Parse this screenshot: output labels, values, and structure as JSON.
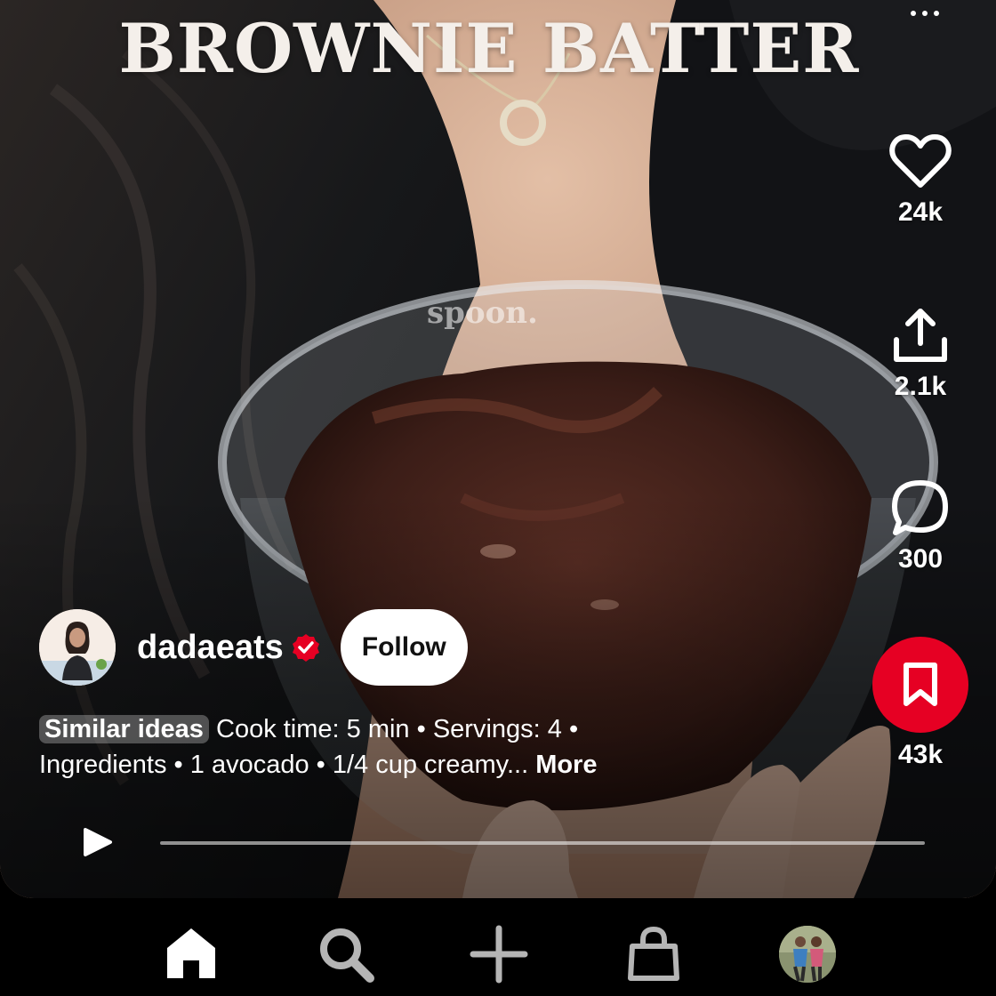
{
  "video": {
    "title_overlay": "BROWNIE BATTER",
    "jar_print": "spoon.",
    "progress": 0.0
  },
  "actions": {
    "like_count": "24k",
    "share_count": "2.1k",
    "comment_count": "300",
    "save_count": "43k",
    "save_color": "#e60023"
  },
  "creator": {
    "username": "dadaeats",
    "follow_label": "Follow",
    "verified_color": "#e60023"
  },
  "description": {
    "similar_label": "Similar ideas",
    "line1_text": " Cook time: 5 min • Servings: 4 •",
    "line2_text": "Ingredients • 1 avocado  • 1/4 cup creamy... ",
    "more_label": "More"
  },
  "icons": {
    "menu": "more-horizontal-icon",
    "like": "heart-icon",
    "share": "share-upload-icon",
    "comment": "comment-bubble-icon",
    "save": "bookmark-icon",
    "play": "play-icon",
    "nav_home": "home-icon",
    "nav_search": "search-icon",
    "nav_create": "plus-icon",
    "nav_shop": "shopping-bag-icon",
    "nav_profile": "profile-avatar"
  }
}
